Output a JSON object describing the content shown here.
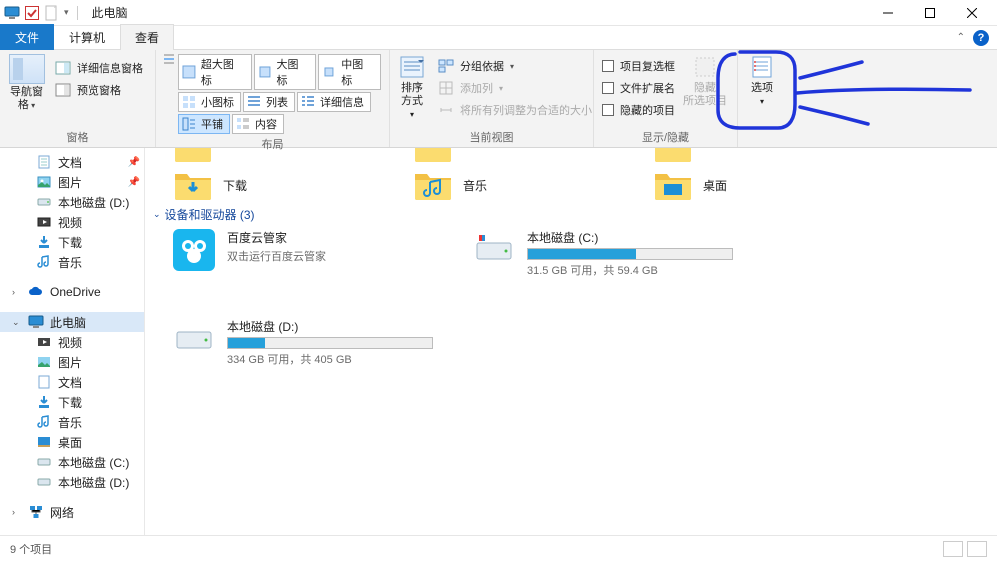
{
  "window": {
    "title": "此电脑"
  },
  "tabs": {
    "file": "文件",
    "computer": "计算机",
    "view": "查看"
  },
  "ribbon": {
    "pane_group": {
      "nav_pane": "导航窗格",
      "detail_info": "详细信息窗格",
      "preview": "预览窗格",
      "label": "窗格"
    },
    "layout_group": {
      "extra_large": "超大图标",
      "large": "大图标",
      "medium": "中图标",
      "small": "小图标",
      "list": "列表",
      "details": "详细信息",
      "tiles": "平铺",
      "content": "内容",
      "label": "布局"
    },
    "sort_btn": "排序方式",
    "view_group": {
      "group_by": "分组依据",
      "add_columns": "添加列",
      "size_all": "将所有列调整为合适的大小",
      "label": "当前视图"
    },
    "show_group": {
      "item_checkboxes": "项目复选框",
      "file_ext": "文件扩展名",
      "hidden_items": "隐藏的项目",
      "hide_selected": "隐藏\n所选项目",
      "label": "显示/隐藏"
    },
    "options": "选项"
  },
  "nav": {
    "documents": "文档",
    "pictures": "图片",
    "local_d": "本地磁盘 (D:)",
    "videos": "视频",
    "downloads": "下载",
    "music": "音乐",
    "onedrive": "OneDrive",
    "this_pc": "此电脑",
    "videos2": "视频",
    "pictures2": "图片",
    "documents2": "文档",
    "downloads2": "下载",
    "music2": "音乐",
    "desktop": "桌面",
    "local_c": "本地磁盘 (C:)",
    "local_d2": "本地磁盘 (D:)",
    "network": "网络"
  },
  "main": {
    "folders_partial": [
      {
        "name": "下载"
      },
      {
        "name": "音乐"
      },
      {
        "name": "桌面"
      }
    ],
    "devices_header": "设备和驱动器 (3)",
    "baidu": {
      "title": "百度云管家",
      "sub": "双击运行百度云管家"
    },
    "drive_c": {
      "title": "本地磁盘 (C:)",
      "used_pct": 53,
      "text": "31.5 GB 可用，共 59.4 GB"
    },
    "drive_d": {
      "title": "本地磁盘 (D:)",
      "used_pct": 18,
      "text": "334 GB 可用，共 405 GB"
    }
  },
  "status": {
    "text": "9 个项目"
  }
}
